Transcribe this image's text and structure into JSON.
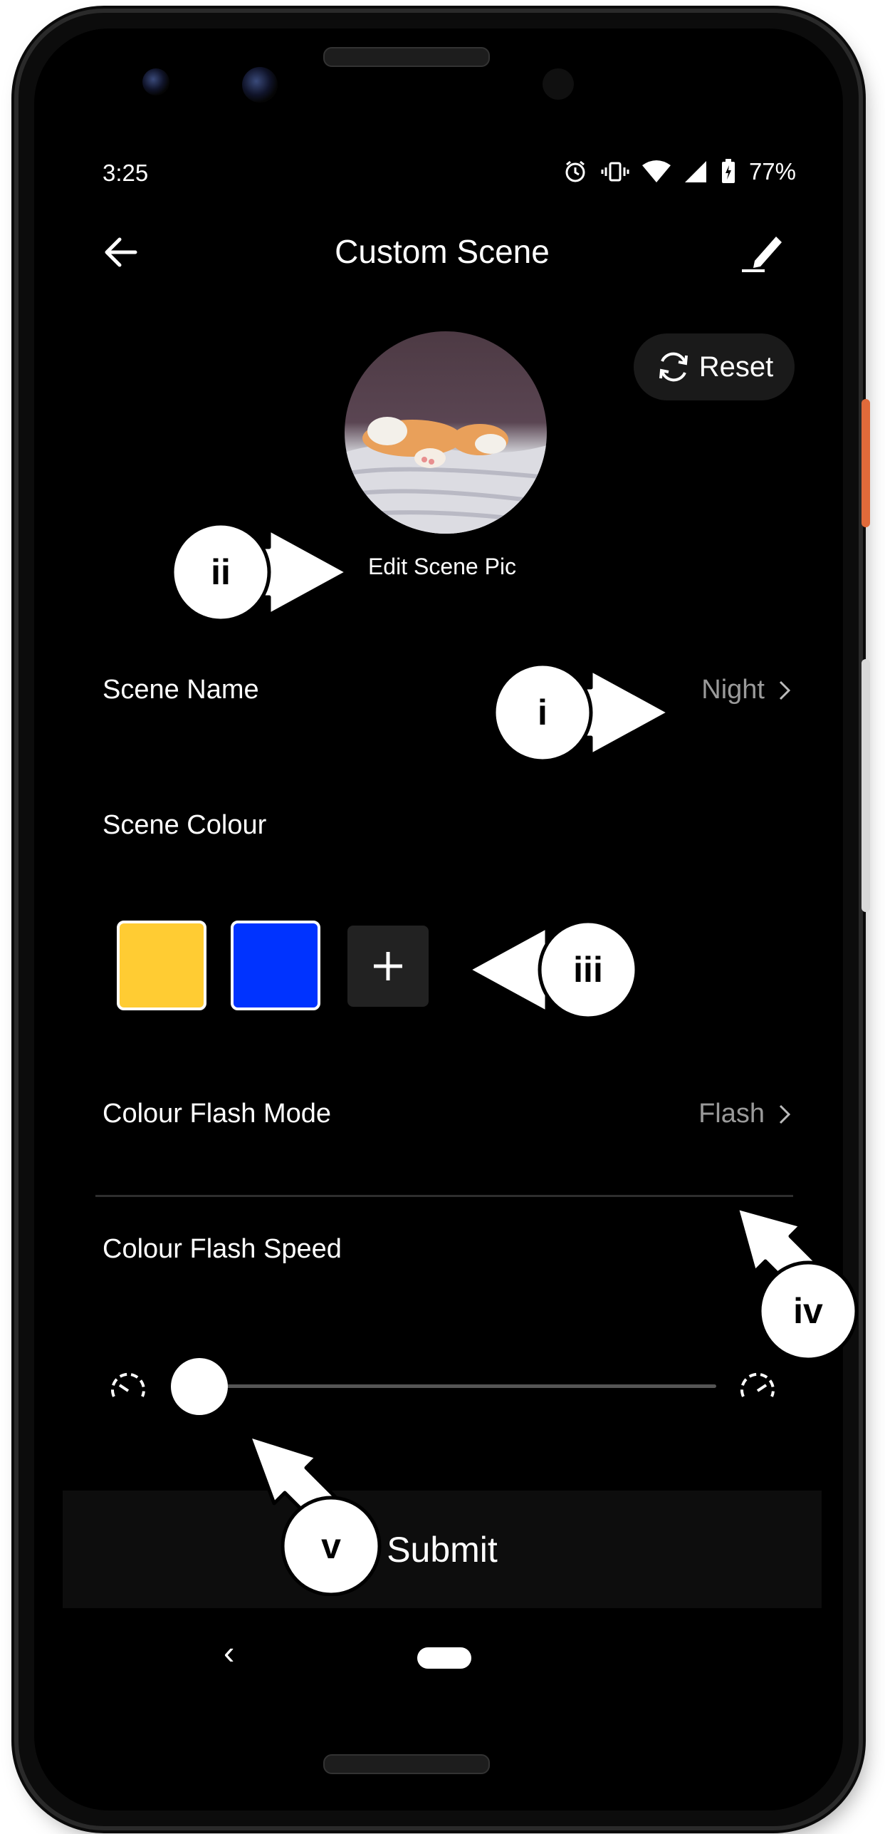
{
  "status_bar": {
    "time": "3:25",
    "battery": "77%",
    "icons": [
      "alarm-icon",
      "vibrate-icon",
      "wifi-icon",
      "signal-icon",
      "battery-icon"
    ]
  },
  "app_bar": {
    "title": "Custom Scene",
    "back_icon": "back-arrow-icon",
    "edit_icon": "edit-pencil-icon"
  },
  "reset": {
    "label": "Reset",
    "icon": "refresh-icon"
  },
  "scene_pic": {
    "edit_label": "Edit Scene Pic"
  },
  "scene_name": {
    "label": "Scene Name",
    "value": "Night"
  },
  "scene_colour": {
    "label": "Scene Colour",
    "swatches": [
      "#ffcc33",
      "#0033ff"
    ],
    "add_icon": "plus-icon"
  },
  "flash_mode": {
    "label": "Colour Flash Mode",
    "value": "Flash"
  },
  "flash_speed": {
    "label": "Colour Flash Speed",
    "level": 0.0,
    "slow_icon": "speed-slow-icon",
    "fast_icon": "speed-fast-icon"
  },
  "submit": {
    "label": "Submit"
  },
  "nav": {
    "back": "‹"
  },
  "annotations": {
    "i": "i",
    "ii": "ii",
    "iii": "iii",
    "iv": "iv",
    "v": "v"
  },
  "colors": {
    "background": "#000000",
    "text": "#ffffff",
    "muted_text": "#9a9a9a",
    "accent_orange": "#e06a3a"
  }
}
